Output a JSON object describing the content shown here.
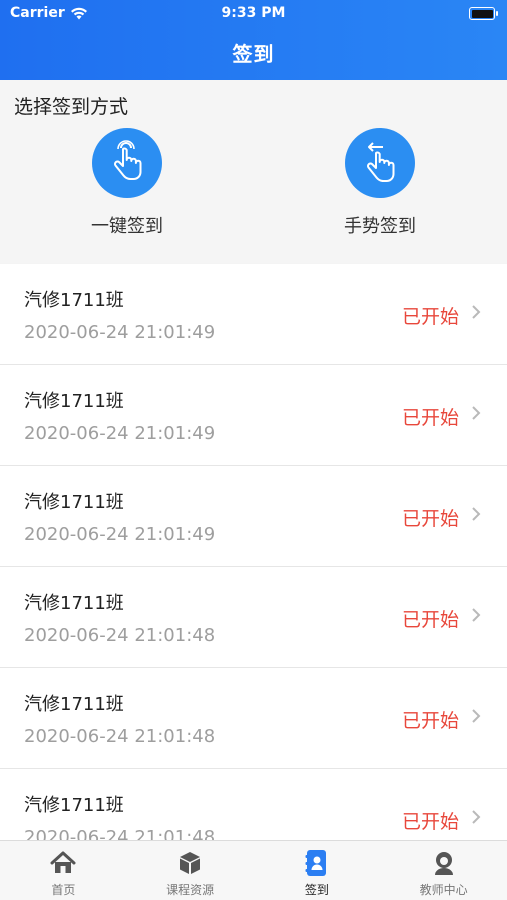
{
  "status_bar": {
    "carrier": "Carrier",
    "time": "9:33 PM",
    "battery_level": 1.0
  },
  "nav": {
    "title": "签到"
  },
  "method": {
    "title": "选择签到方式",
    "options": [
      {
        "label": "一键签到",
        "icon": "tap-hand-icon"
      },
      {
        "label": "手势签到",
        "icon": "swipe-hand-icon"
      }
    ]
  },
  "records": [
    {
      "name": "汽修1711班",
      "time": "2020-06-24 21:01:49",
      "status": "已开始"
    },
    {
      "name": "汽修1711班",
      "time": "2020-06-24 21:01:49",
      "status": "已开始"
    },
    {
      "name": "汽修1711班",
      "time": "2020-06-24 21:01:49",
      "status": "已开始"
    },
    {
      "name": "汽修1711班",
      "time": "2020-06-24 21:01:48",
      "status": "已开始"
    },
    {
      "name": "汽修1711班",
      "time": "2020-06-24 21:01:48",
      "status": "已开始"
    },
    {
      "name": "汽修1711班",
      "time": "2020-06-24 21:01:48",
      "status": "已开始"
    }
  ],
  "tabs": [
    {
      "label": "首页",
      "icon": "home-icon",
      "active": false
    },
    {
      "label": "课程资源",
      "icon": "cube-icon",
      "active": false
    },
    {
      "label": "签到",
      "icon": "contacts-book-icon",
      "active": true
    },
    {
      "label": "教师中心",
      "icon": "user-icon",
      "active": false
    }
  ],
  "colors": {
    "primary": "#2b8ef2",
    "status_red": "#e8473b",
    "header_start": "#1f6ff0",
    "header_end": "#2a86f5"
  }
}
